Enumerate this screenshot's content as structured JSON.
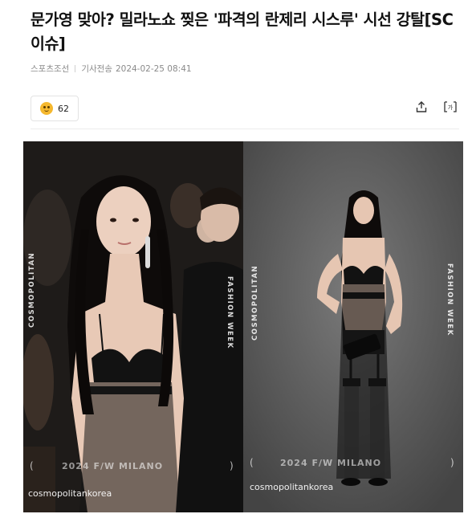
{
  "article": {
    "headline": "문가영 맞아? 밀라노쇼 찢은 '파격의 란제리 시스루' 시선 강탈[SC이슈]",
    "source": "스포츠조선",
    "date_label": "기사전송",
    "date": "2024-02-25 08:41"
  },
  "reactions": {
    "count": "62",
    "icon": "smiley-emoji-icon"
  },
  "toolbar": {
    "share_icon": "share-icon",
    "font_icon": "text-size-icon",
    "font_label": "가가"
  },
  "photo": {
    "left_panel": {
      "vertical_left": "COSMOPOLITAN",
      "vertical_right": "FASHION WEEK",
      "caption": "2024 F/W     MILANO",
      "handle": "cosmopolitankorea"
    },
    "right_panel": {
      "vertical_left": "COSMOPOLITAN",
      "vertical_right": "FASHION WEEK",
      "caption": "2024 F/W     MILANO",
      "handle": "cosmopolitankorea"
    },
    "colors": {
      "left_bg": "#2a2420",
      "right_bg": "#5c5c5c",
      "outfit": "#141414",
      "skin": "#e8c9b6"
    }
  }
}
